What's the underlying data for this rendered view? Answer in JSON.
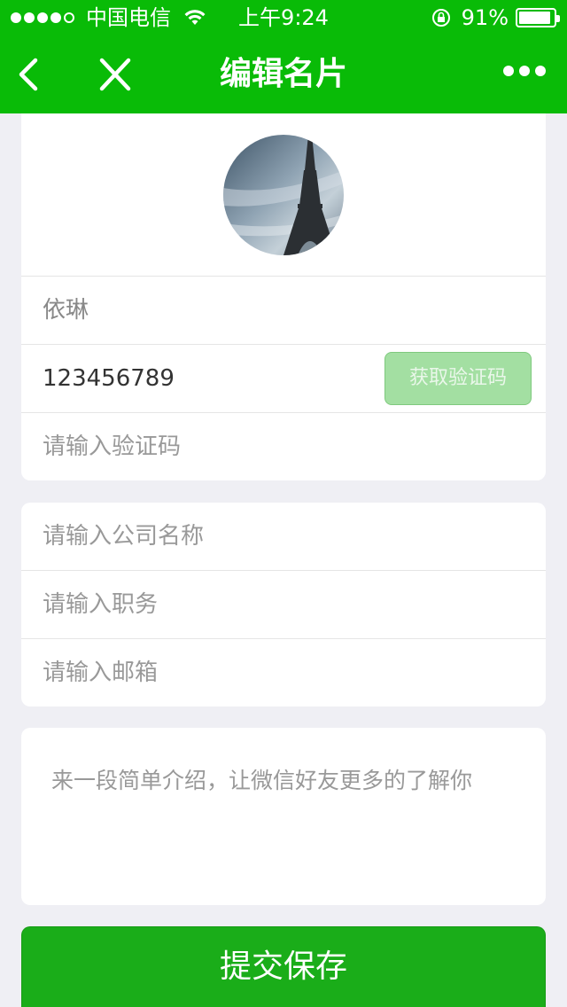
{
  "status_bar": {
    "carrier": "中国电信",
    "time": "上午9:24",
    "battery_percent": "91%",
    "battery_level": 0.91,
    "signal_bars_filled": 4,
    "signal_bars_total": 5
  },
  "navbar": {
    "title": "编辑名片",
    "back_icon": "chevron-left-icon",
    "close_icon": "close-icon",
    "more_icon": "more-dots-icon"
  },
  "profile": {
    "avatar_image": "eiffel-tower-photo",
    "name": "依琳",
    "phone": "123456789",
    "get_code_label": "获取验证码",
    "code_placeholder": "请输入验证码"
  },
  "work": {
    "company_placeholder": "请输入公司名称",
    "title_placeholder": "请输入职务",
    "email_placeholder": "请输入邮箱"
  },
  "intro": {
    "placeholder": "来一段简单介绍，让微信好友更多的了解你"
  },
  "submit_label": "提交保存",
  "colors": {
    "brand_green": "#09bb07",
    "button_green": "#1aad19",
    "disabled_green": "#a3dfa2",
    "background": "#efeff4"
  }
}
